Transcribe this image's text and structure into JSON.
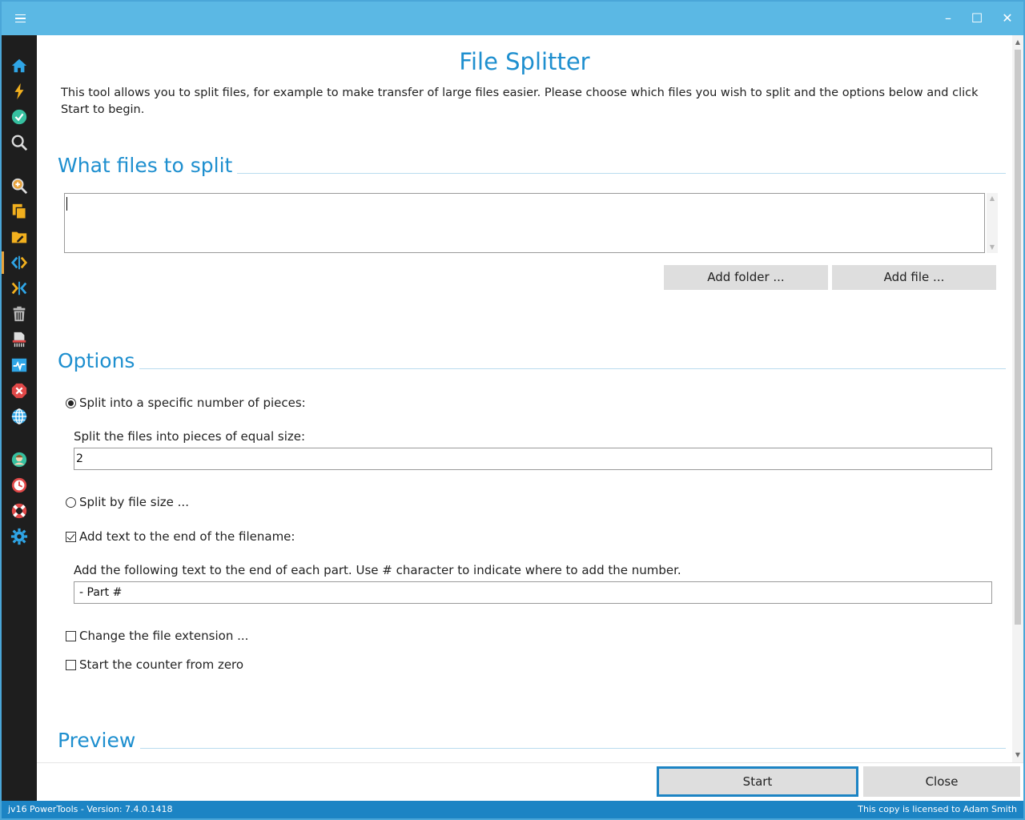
{
  "window": {
    "controls": {
      "minimize": "–",
      "maximize": "☐",
      "close": "✕"
    }
  },
  "sidebar": {
    "items": [
      {
        "icon": "home-icon",
        "color": "#2fa5e6"
      },
      {
        "icon": "lightning-icon",
        "color": "#f2b01e"
      },
      {
        "icon": "check-circle-icon",
        "color": "#36c0a0"
      },
      {
        "icon": "search-icon",
        "color": "#dddddd"
      },
      {
        "icon": "zoom-in-icon",
        "color": "#e8a33b"
      },
      {
        "icon": "copy-icon",
        "color": "#f2b01e"
      },
      {
        "icon": "folder-edit-icon",
        "color": "#f2b01e"
      },
      {
        "icon": "split-icon",
        "color": "#2fa5e6"
      },
      {
        "icon": "merge-icon",
        "color": "#2fa5e6"
      },
      {
        "icon": "trash-icon",
        "color": "#bbbbbb"
      },
      {
        "icon": "shredder-icon",
        "color": "#dddddd"
      },
      {
        "icon": "monitor-icon",
        "color": "#2fa5e6"
      },
      {
        "icon": "blocked-icon",
        "color": "#e04848"
      },
      {
        "icon": "globe-icon",
        "color": "#2fa5e6"
      },
      {
        "icon": "user-icon",
        "color": "#36c0a0"
      },
      {
        "icon": "clock-icon",
        "color": "#e04848"
      },
      {
        "icon": "lifebuoy-icon",
        "color": "#e04848"
      },
      {
        "icon": "gear-icon",
        "color": "#2fa5e6"
      }
    ]
  },
  "page": {
    "title": "File Splitter",
    "intro": "This tool allows you to split files, for example to make transfer of large files easier. Please choose which files you wish to split and the options below and click Start to begin."
  },
  "files": {
    "heading": "What files to split",
    "add_folder": "Add folder ...",
    "add_file": "Add file ..."
  },
  "options": {
    "heading": "Options",
    "split_pieces": {
      "label": "Split into a specific number of pieces:",
      "selected": true
    },
    "equal_label": "Split the files into pieces of equal size:",
    "pieces_value": "2",
    "split_size": {
      "label": "Split by file size ...",
      "selected": false
    },
    "add_text": {
      "label": "Add text to the end of the filename:",
      "checked": true
    },
    "add_text_desc": "Add the following text to the end of each part. Use # character to indicate where to add the number.",
    "add_text_value": "- Part #",
    "change_ext": {
      "label": "Change the file extension ...",
      "checked": false
    },
    "counter_zero": {
      "label": "Start the counter from zero",
      "checked": false
    }
  },
  "preview": {
    "heading": "Preview"
  },
  "footer": {
    "start": "Start",
    "close": "Close"
  },
  "status": {
    "left": "jv16 PowerTools - Version: 7.4.0.1418",
    "right": "This copy is licensed to Adam Smith"
  },
  "colors": {
    "accent": "#1e8fcf",
    "titlebar": "#5bb8e4",
    "statusbar": "#1c84c4",
    "sidebar": "#1e1e1e"
  }
}
